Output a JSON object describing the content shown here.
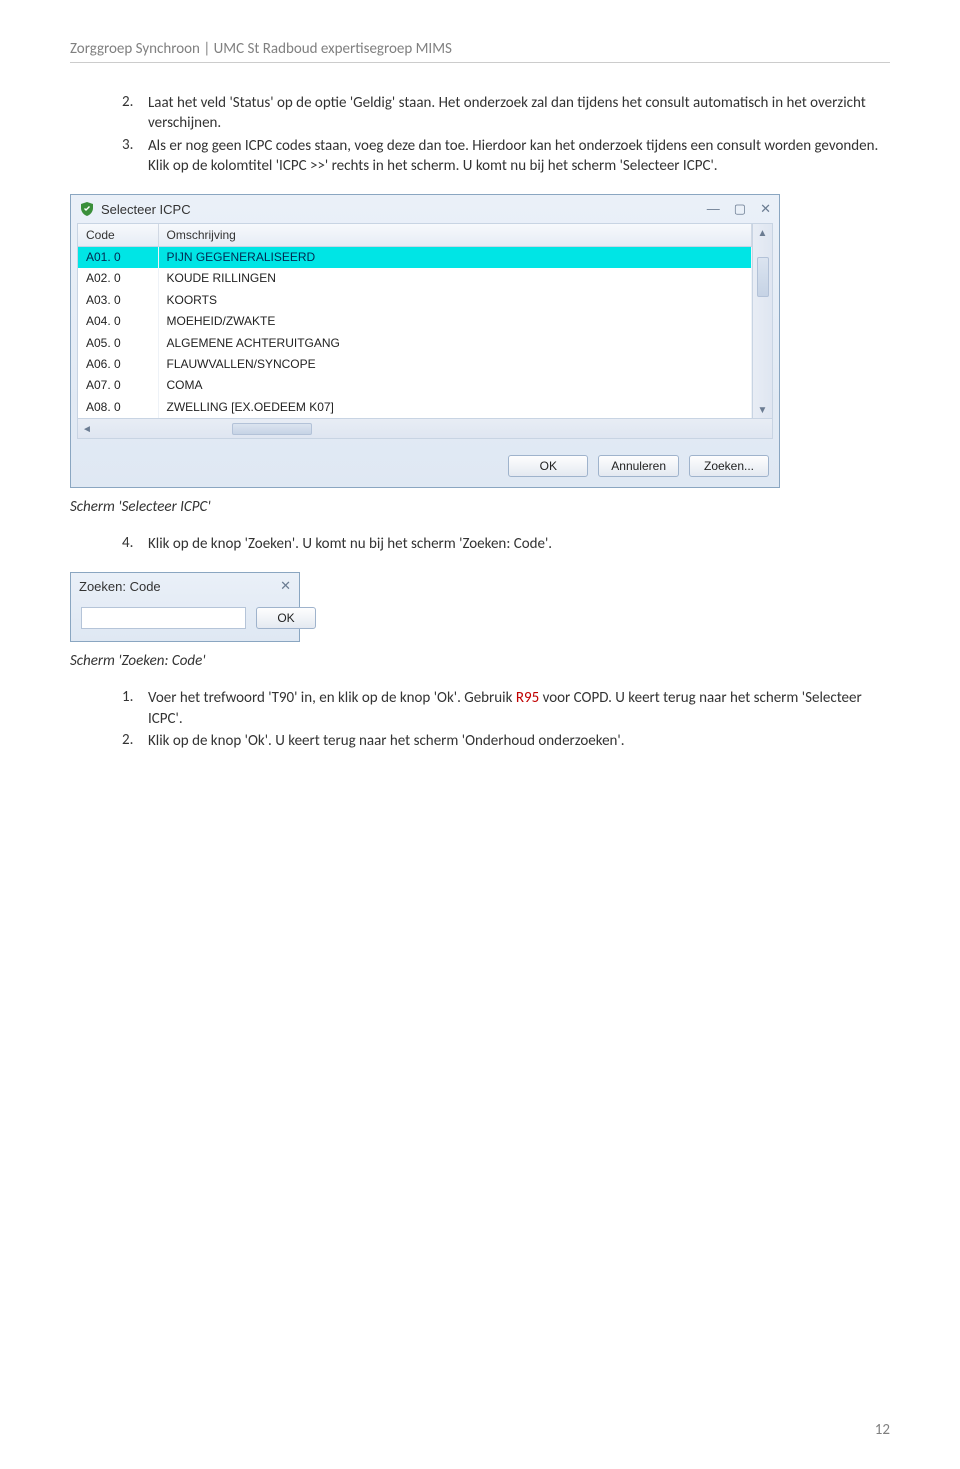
{
  "header": "Zorggroep Synchroon | UMC St Radboud expertisegroep MIMS",
  "list_a": [
    {
      "n": "2.",
      "t": "Laat het veld 'Status' op de optie 'Geldig' staan. Het onderzoek zal dan tijdens het consult automatisch in het overzicht verschijnen."
    },
    {
      "n": "3.",
      "t": "Als er nog geen ICPC codes staan, voeg deze dan toe. Hierdoor kan het onderzoek tijdens een consult worden gevonden. Klik op de kolomtitel 'ICPC >>' rechts in het scherm. U komt nu bij het scherm 'Selecteer ICPC'."
    }
  ],
  "win1": {
    "title": "Selecteer ICPC",
    "headers": [
      "Code",
      "Omschrijving"
    ],
    "rows": [
      {
        "code": "A01.  0",
        "desc": "PIJN GEGENERALISEERD",
        "sel": true
      },
      {
        "code": "A02.  0",
        "desc": "KOUDE RILLINGEN"
      },
      {
        "code": "A03.  0",
        "desc": "KOORTS"
      },
      {
        "code": "A04.  0",
        "desc": "MOEHEID/ZWAKTE"
      },
      {
        "code": "A05.  0",
        "desc": "ALGEMENE ACHTERUITGANG"
      },
      {
        "code": "A06.  0",
        "desc": "FLAUWVALLEN/SYNCOPE"
      },
      {
        "code": "A07.  0",
        "desc": "COMA"
      },
      {
        "code": "A08.  0",
        "desc": "ZWELLING [EX.OEDEEM K07]"
      }
    ],
    "buttons": {
      "ok": "OK",
      "cancel": "Annuleren",
      "search": "Zoeken..."
    }
  },
  "caption1": "Scherm 'Selecteer ICPC'",
  "list_b": [
    {
      "n": "4.",
      "t": "Klik op de knop 'Zoeken'. U komt nu bij het scherm 'Zoeken: Code'."
    }
  ],
  "win2": {
    "title": "Zoeken: Code",
    "ok": "OK"
  },
  "caption2": "Scherm 'Zoeken: Code'",
  "list_c": [
    {
      "n": "1.",
      "t_pre": "Voer het trefwoord 'T90' in, en klik op de knop 'Ok'. Gebruik ",
      "t_red": "R95",
      "t_post": " voor COPD. U keert terug naar het scherm 'Selecteer ICPC'."
    },
    {
      "n": "2.",
      "t": "Klik op de knop 'Ok'. U keert terug naar het scherm 'Onderhoud onderzoeken'."
    }
  ],
  "page": "12"
}
